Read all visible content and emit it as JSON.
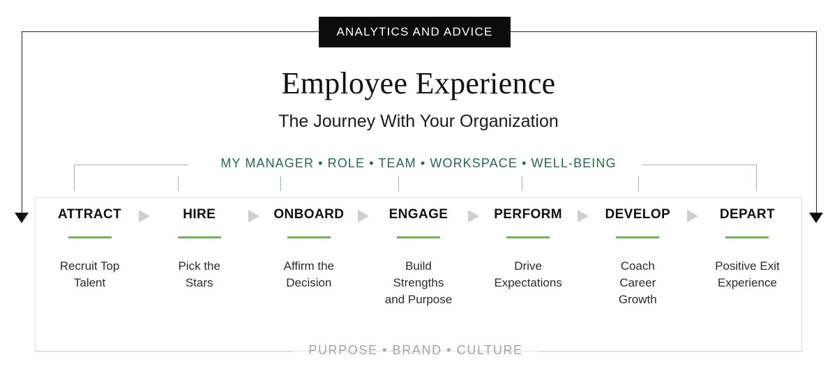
{
  "banner": {
    "label": "ANALYTICS AND ADVICE"
  },
  "header": {
    "title": "Employee Experience",
    "subtitle": "The Journey With Your Organization"
  },
  "drivers": {
    "text": "MY MANAGER • ROLE • TEAM • WORKSPACE • WELL-BEING",
    "color": "#246b45",
    "items": [
      "MY MANAGER",
      "ROLE",
      "TEAM",
      "WORKSPACE",
      "WELL-BEING"
    ]
  },
  "stages": [
    {
      "label": "ATTRACT",
      "desc": "Recruit Top\nTalent"
    },
    {
      "label": "HIRE",
      "desc": "Pick the\nStars"
    },
    {
      "label": "ONBOARD",
      "desc": "Affirm the\nDecision"
    },
    {
      "label": "ENGAGE",
      "desc": "Build\nStrengths\nand Purpose"
    },
    {
      "label": "PERFORM",
      "desc": "Drive\nExpectations"
    },
    {
      "label": "DEVELOP",
      "desc": "Coach\nCareer\nGrowth"
    },
    {
      "label": "DEPART",
      "desc": "Positive Exit\nExperience"
    }
  ],
  "footer": {
    "text": "PURPOSE • BRAND • CULTURE",
    "items": [
      "PURPOSE",
      "BRAND",
      "CULTURE"
    ],
    "color": "#a3a3a8"
  },
  "accents": {
    "stage_rule": "#6eb459",
    "bracket": "#9bbda9",
    "arrow": "#cfcfcf",
    "banner_bg": "#0c0c0c"
  }
}
